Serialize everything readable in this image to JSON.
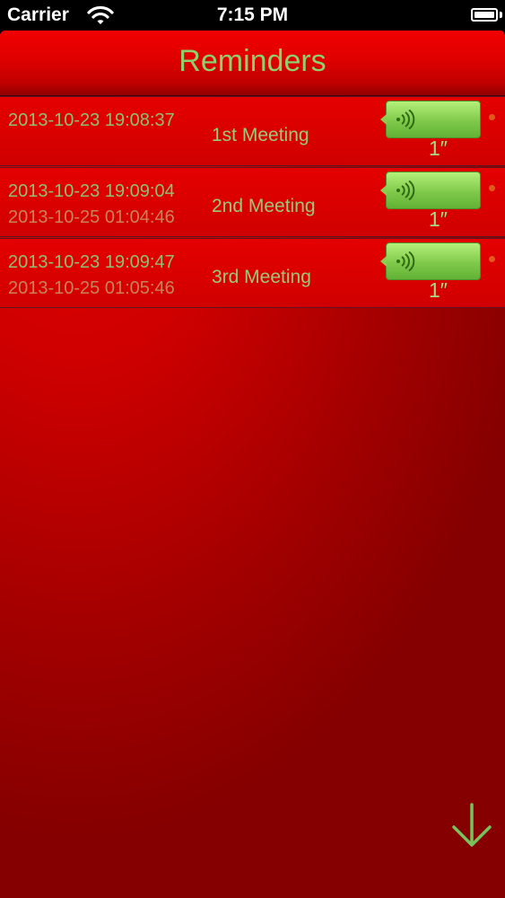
{
  "status_bar": {
    "carrier": "Carrier",
    "time": "7:15 PM",
    "wifi_icon": "wifi-icon",
    "battery_icon": "battery-icon"
  },
  "nav": {
    "title": "Reminders"
  },
  "reminders": [
    {
      "date": "2013-10-23 19:08:37",
      "date2": "",
      "title": "1st Meeting",
      "duration": "1″",
      "icon": "voice-bubble-icon"
    },
    {
      "date": "2013-10-23 19:09:04",
      "date2": "2013-10-25 01:04:46",
      "title": "2nd Meeting",
      "duration": "1″",
      "icon": "voice-bubble-icon"
    },
    {
      "date": "2013-10-23 19:09:47",
      "date2": "2013-10-25 01:05:46",
      "title": "3rd Meeting",
      "duration": "1″",
      "icon": "voice-bubble-icon"
    }
  ],
  "scroll_button_icon": "arrow-down-icon",
  "colors": {
    "background_red": "#d00000",
    "text_green": "#8ed16b",
    "bubble_green": "#7fc94a",
    "dot_orange": "#e25a1a"
  }
}
